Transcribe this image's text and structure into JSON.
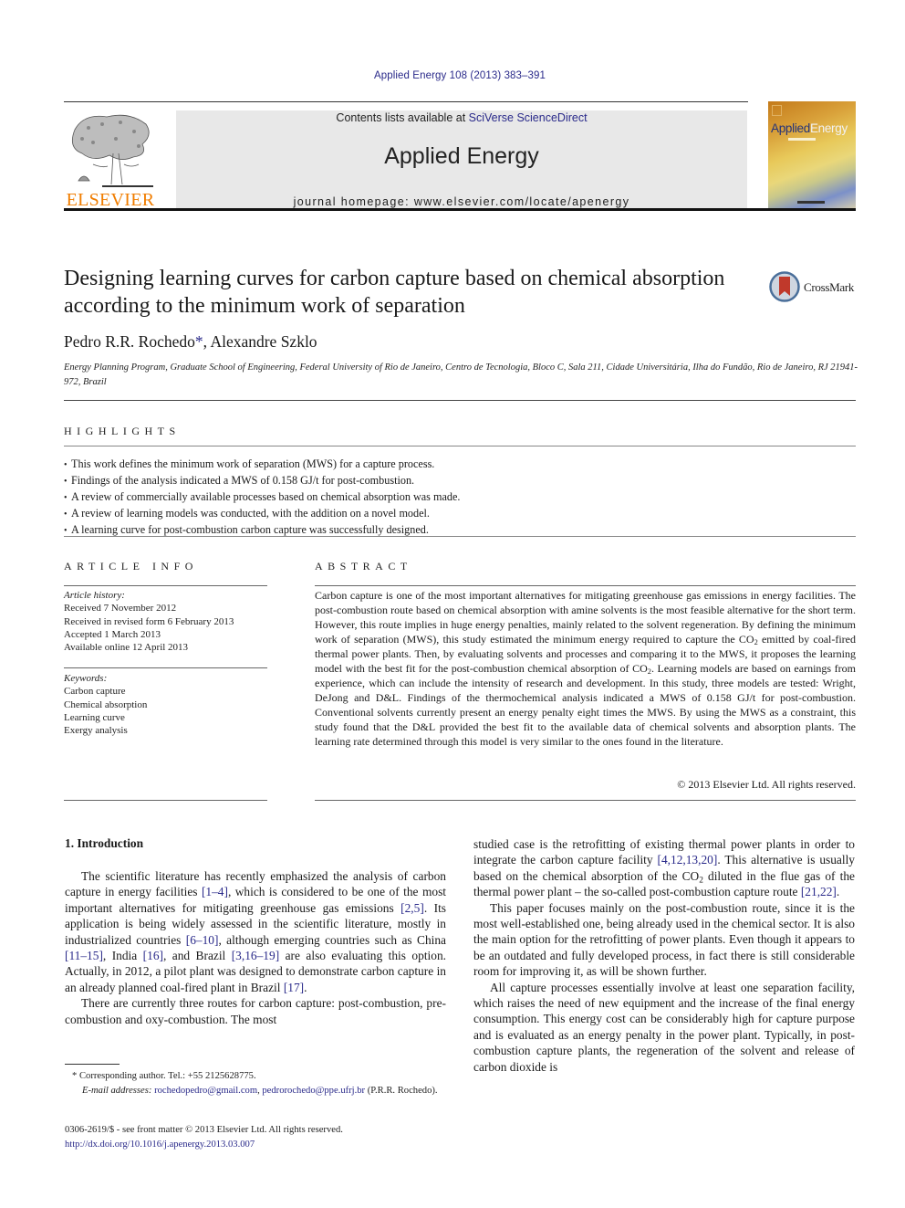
{
  "journal_ref": "Applied Energy 108 (2013) 383–391",
  "masthead": {
    "contents_prefix": "Contents lists available at ",
    "contents_link": "SciVerse ScienceDirect",
    "journal_title": "Applied Energy",
    "homepage": "journal homepage: www.elsevier.com/locate/apenergy",
    "publisher_logo_text": "ELSEVIER",
    "cover_title_a": "Applied",
    "cover_title_b": "Energy",
    "crossmark_label": "CrossMark"
  },
  "colors": {
    "link": "#2a2a8a",
    "elsevier_orange": "#f07d00",
    "masthead_bg": "#e8e8e8"
  },
  "article": {
    "title": "Designing learning curves for carbon capture based on chemical absorption according to the minimum work of separation",
    "authors": [
      {
        "name": "Pedro R.R. Rochedo",
        "mark": "*"
      },
      {
        "name": "Alexandre Szklo",
        "mark": ""
      }
    ],
    "author_separator": ", ",
    "affiliation": "Energy Planning Program, Graduate School of Engineering, Federal University of Rio de Janeiro, Centro de Tecnologia, Bloco C, Sala 211, Cidade Universitária, Ilha do Fundão, Rio de Janeiro, RJ 21941-972, Brazil"
  },
  "highlights": {
    "heading": "HIGHLIGHTS",
    "items": [
      "This work defines the minimum work of separation (MWS) for a capture process.",
      "Findings of the analysis indicated a MWS of 0.158 GJ/t for post-combustion.",
      "A review of commercially available processes based on chemical absorption was made.",
      "A review of learning models was conducted, with the addition on a novel model.",
      "A learning curve for post-combustion carbon capture was successfully designed."
    ]
  },
  "article_info": {
    "heading": "ARTICLE INFO",
    "history_label": "Article history:",
    "history": [
      "Received 7 November 2012",
      "Received in revised form 6 February 2013",
      "Accepted 1 March 2013",
      "Available online 12 April 2013"
    ],
    "keywords_label": "Keywords:",
    "keywords": [
      "Carbon capture",
      "Chemical absorption",
      "Learning curve",
      "Exergy analysis"
    ]
  },
  "abstract": {
    "heading": "ABSTRACT",
    "part1": "Carbon capture is one of the most important alternatives for mitigating greenhouse gas emissions in energy facilities. The post-combustion route based on chemical absorption with amine solvents is the most feasible alternative for the short term. However, this route implies in huge energy penalties, mainly related to the solvent regeneration. By defining the minimum work of separation (MWS), this study estimated the minimum energy required to capture the CO",
    "part2": " emitted by coal-fired thermal power plants. Then, by evaluating solvents and processes and comparing it to the MWS, it proposes the learning model with the best fit for the post-combustion chemical absorption of CO",
    "part3": ". Learning models are based on earnings from experience, which can include the intensity of research and development. In this study, three models are tested: Wright, DeJong and D&L. Findings of the thermochemical analysis indicated a MWS of 0.158 GJ/t for post-combustion. Conventional solvents currently present an energy penalty eight times the MWS. By using the MWS as a constraint, this study found that the D&L provided the best fit to the available data of chemical solvents and absorption plants. The learning rate determined through this model is very similar to the ones found in the literature.",
    "subscript": "2",
    "copyright": "© 2013 Elsevier Ltd. All rights reserved."
  },
  "intro": {
    "heading": "1. Introduction",
    "p1": [
      {
        "t": "The scientific literature has recently emphasized the analysis of carbon capture in energy facilities "
      },
      {
        "c": "[1–4]"
      },
      {
        "t": ", which is considered to be one of the most important alternatives for mitigating greenhouse gas emissions "
      },
      {
        "c": "[2,5]"
      },
      {
        "t": ". Its application is being widely assessed in the scientific literature, mostly in industrialized countries "
      },
      {
        "c": "[6–10]"
      },
      {
        "t": ", although emerging countries such as China "
      },
      {
        "c": "[11–15]"
      },
      {
        "t": ", India "
      },
      {
        "c": "[16]"
      },
      {
        "t": ", and Brazil "
      },
      {
        "c": "[3,16–19]"
      },
      {
        "t": " are also evaluating this option. Actually, in 2012, a pilot plant was designed to demonstrate carbon capture in an already planned coal-fired plant in Brazil "
      },
      {
        "c": "[17]"
      },
      {
        "t": "."
      }
    ],
    "p2": "There are currently three routes for carbon capture: post-combustion, pre-combustion and oxy-combustion. The most",
    "p2_cont": [
      {
        "t": "studied case is the retrofitting of existing thermal power plants in order to integrate the carbon capture facility "
      },
      {
        "c": "[4,12,13,20]"
      },
      {
        "t": ". This alternative is usually based on the chemical absorption of the CO"
      },
      {
        "s": "2"
      },
      {
        "t": " diluted in the flue gas of the thermal power plant – the so-called post-combustion capture route "
      },
      {
        "c": "[21,22]"
      },
      {
        "t": "."
      }
    ],
    "p3": "This paper focuses mainly on the post-combustion route, since it is the most well-established one, being already used in the chemical sector. It is also the main option for the retrofitting of power plants. Even though it appears to be an outdated and fully developed process, in fact there is still considerable room for improving it, as will be shown further.",
    "p4": "All capture processes essentially involve at least one separation facility, which raises the need of new equipment and the increase of the final energy consumption. This energy cost can be considerably high for capture purpose and is evaluated as an energy penalty in the power plant. Typically, in post-combustion capture plants, the regeneration of the solvent and release of carbon dioxide is"
  },
  "footnote": {
    "marker": "*",
    "corresponding": "Corresponding author. Tel.: +55 2125628775.",
    "email_label": "E-mail addresses:",
    "email1": "rochedopedro@gmail.com",
    "email_sep": ", ",
    "email2": "pedrorochedo@ppe.ufrj.br",
    "email_owner": " (P.R.R. Rochedo)."
  },
  "front_matter": {
    "issn_line": "0306-2619/$ - see front matter © 2013 Elsevier Ltd. All rights reserved.",
    "doi": "http://dx.doi.org/10.1016/j.apenergy.2013.03.007"
  }
}
